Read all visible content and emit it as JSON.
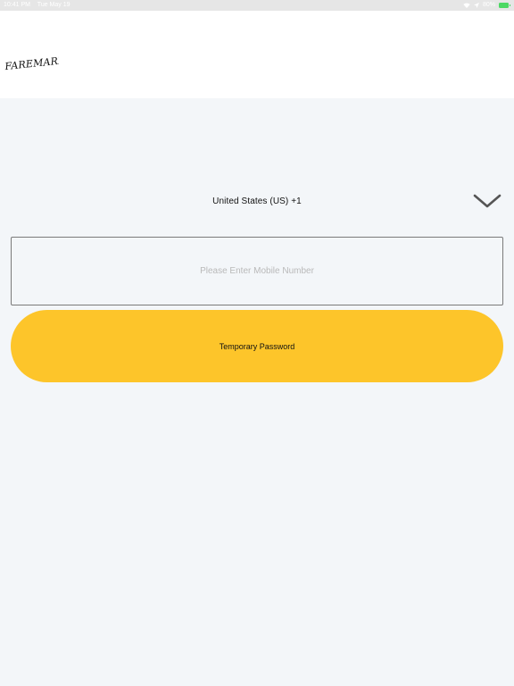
{
  "status_bar": {
    "time": "10:41 PM",
    "date": "Tue May 19",
    "battery": "80%"
  },
  "header": {
    "logo_text": "FAREMARKET"
  },
  "country_select": {
    "selected": "United States (US) +1"
  },
  "phone_input": {
    "value": "",
    "placeholder": "Please Enter Mobile Number"
  },
  "primary_button": {
    "label": "Temporary Password"
  },
  "colors": {
    "accent": "#fdc52a",
    "background": "#f3f6f9",
    "header": "#ffffff",
    "battery": "#4cd964"
  },
  "icons": [
    "wifi-icon",
    "location-arrow-icon",
    "battery-icon",
    "chevron-down-icon"
  ]
}
